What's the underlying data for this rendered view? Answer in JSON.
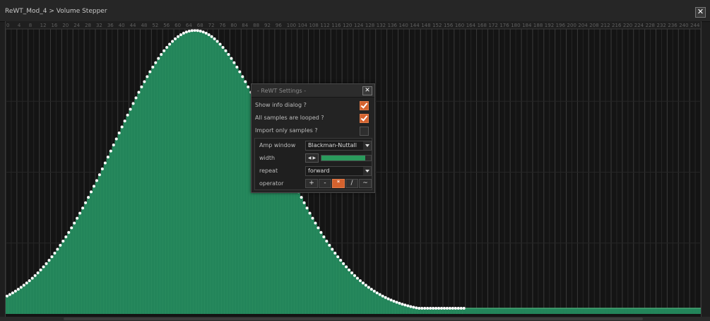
{
  "window": {
    "title": "ReWT_Mod_4 > Volume Stepper",
    "close_glyph": "✕"
  },
  "ruler": {
    "labels": [
      "0",
      "4",
      "8",
      "12",
      "16",
      "20",
      "24",
      "28",
      "32",
      "36",
      "40",
      "44",
      "48",
      "52",
      "56",
      "60",
      "64",
      "68",
      "72",
      "76",
      "80",
      "84",
      "88",
      "92",
      "96",
      "100",
      "104",
      "108",
      "112",
      "116",
      "120",
      "124",
      "128",
      "132",
      "136",
      "140",
      "144",
      "148",
      "152",
      "156",
      "160",
      "164",
      "168",
      "172",
      "176",
      "180",
      "184",
      "188",
      "192",
      "196",
      "200",
      "204",
      "208",
      "212",
      "216",
      "220",
      "224",
      "228",
      "232",
      "236",
      "240",
      "244",
      "248"
    ]
  },
  "steps": {
    "count": 248,
    "active_count": 164,
    "peak_step": 67,
    "shape": "gaussian",
    "sigma": 28.5,
    "baseline": 0.02,
    "fill_color": "#23855a",
    "line_color": "#4fb37d",
    "dot_color": "#ffffff"
  },
  "dialog": {
    "title": "- ReWT Settings -",
    "close_glyph": "✕",
    "options": [
      {
        "label": "Show info dialog ?",
        "checked": true
      },
      {
        "label": "All samples are looped ?",
        "checked": true
      },
      {
        "label": "Import only samples ?",
        "checked": false
      }
    ],
    "amp_window": {
      "label": "Amp window",
      "value": "Blackman-Nuttall"
    },
    "width": {
      "label": "width",
      "nudge_glyph": "◀ ▶",
      "fraction": 0.88
    },
    "repeat": {
      "label": "repeat",
      "value": "forward"
    },
    "operator": {
      "label": "operator",
      "buttons": [
        "+",
        "-",
        "*",
        "/",
        "~"
      ],
      "active": "*"
    },
    "accent_color": "#d4622e"
  }
}
